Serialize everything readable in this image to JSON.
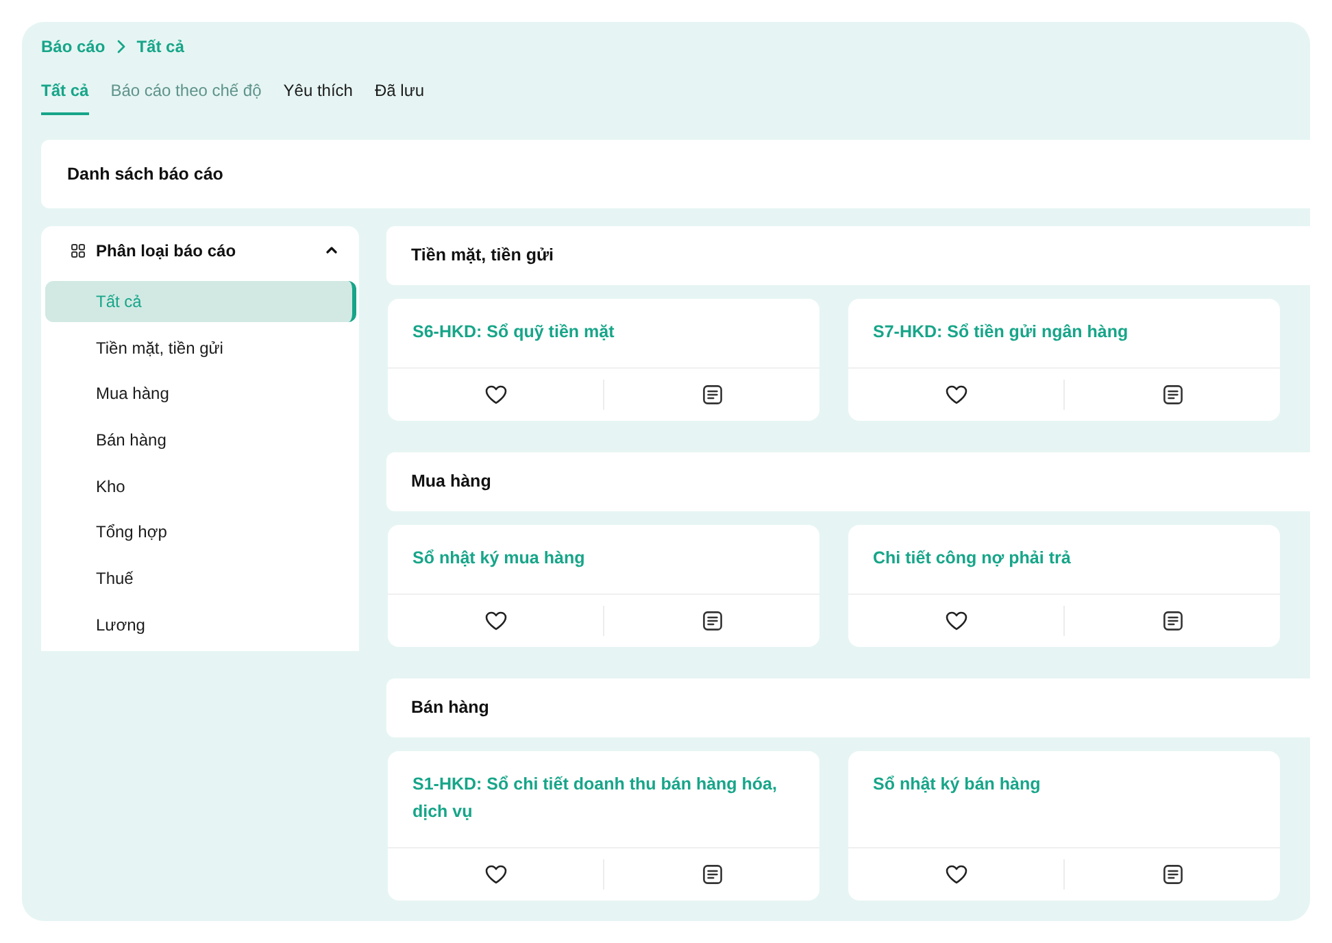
{
  "breadcrumb": [
    {
      "label": "Báo cáo"
    },
    {
      "label": "Tất cả"
    }
  ],
  "tabs": [
    {
      "label": "Tất cả",
      "selected": true,
      "hovered": false
    },
    {
      "label": "Báo cáo theo chế độ",
      "selected": false,
      "hovered": true
    },
    {
      "label": "Yêu thích",
      "selected": false,
      "hovered": false
    },
    {
      "label": "Đã lưu",
      "selected": false,
      "hovered": false
    }
  ],
  "list_header": {
    "title": "Danh sách báo cáo"
  },
  "sidebar": {
    "title": "Phân loại báo cáo",
    "expanded": true,
    "items": [
      {
        "label": "Tất cả",
        "selected": true
      },
      {
        "label": "Tiền mặt, tiền gửi",
        "selected": false
      },
      {
        "label": "Mua hàng",
        "selected": false
      },
      {
        "label": "Bán hàng",
        "selected": false
      },
      {
        "label": "Kho",
        "selected": false
      },
      {
        "label": "Tổng hợp",
        "selected": false
      },
      {
        "label": "Thuế",
        "selected": false
      },
      {
        "label": "Lương",
        "selected": false
      }
    ]
  },
  "sections": [
    {
      "title": "Tiền mặt, tiền gửi",
      "reports": [
        {
          "title": "S6-HKD: Sổ quỹ tiền mặt",
          "favorite": false
        },
        {
          "title": "S7-HKD: Sổ tiền gửi ngân hàng",
          "favorite": false
        }
      ]
    },
    {
      "title": "Mua hàng",
      "reports": [
        {
          "title": "Sổ nhật ký mua hàng",
          "favorite": false
        },
        {
          "title": "Chi tiết công nợ phải trả",
          "favorite": false
        }
      ]
    },
    {
      "title": "Bán hàng",
      "reports": [
        {
          "title": "S1-HKD: Sổ chi tiết doanh thu bán hàng hóa, dịch vụ",
          "favorite": false
        },
        {
          "title": "Sổ nhật ký bán hàng",
          "favorite": false
        }
      ]
    }
  ]
}
